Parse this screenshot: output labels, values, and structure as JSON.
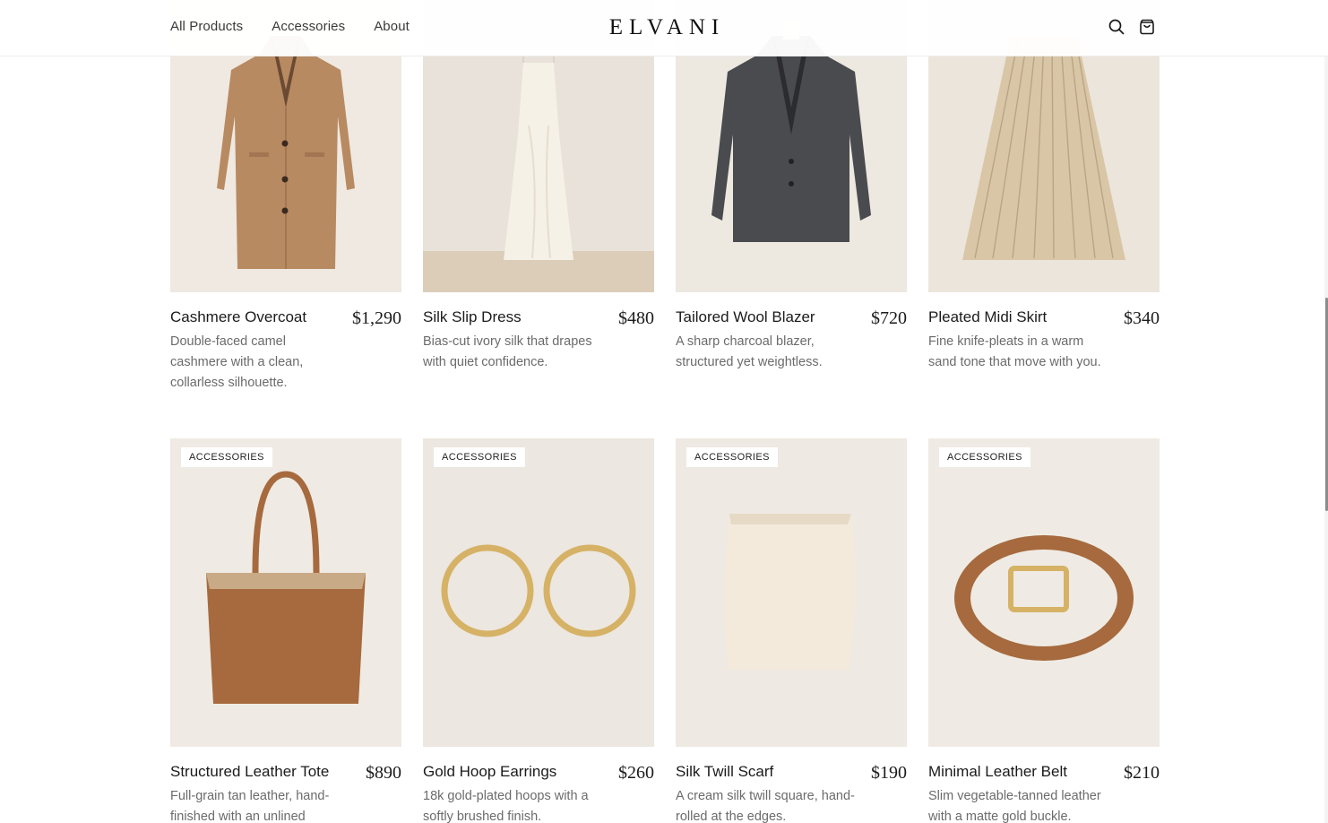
{
  "nav": {
    "links": [
      "All Products",
      "Accessories",
      "About"
    ],
    "logo": "ELVANI",
    "search_icon": "search-icon",
    "cart_icon": "shopping-bag-icon"
  },
  "products": [
    {
      "name": "Cashmere Overcoat",
      "price": "$1,290",
      "description": "Double-faced camel cashmere with a clean, collarless silhouette.",
      "badge": ""
    },
    {
      "name": "Silk Slip Dress",
      "price": "$480",
      "description": "Bias-cut ivory silk that drapes with quiet confidence.",
      "badge": ""
    },
    {
      "name": "Tailored Wool Blazer",
      "price": "$720",
      "description": "A sharp charcoal blazer, structured yet weightless.",
      "badge": ""
    },
    {
      "name": "Pleated Midi Skirt",
      "price": "$340",
      "description": "Fine knife-pleats in a warm sand tone that move with you.",
      "badge": ""
    },
    {
      "name": "Structured Leather Tote",
      "price": "$890",
      "description": "Full-grain tan leather, hand-finished with an unlined",
      "badge": "ACCESSORIES"
    },
    {
      "name": "Gold Hoop Earrings",
      "price": "$260",
      "description": "18k gold-plated hoops with a softly brushed finish.",
      "badge": "ACCESSORIES"
    },
    {
      "name": "Silk Twill Scarf",
      "price": "$190",
      "description": "A cream silk twill square, hand-rolled at the edges.",
      "badge": "ACCESSORIES"
    },
    {
      "name": "Minimal Leather Belt",
      "price": "$210",
      "description": "Slim vegetable-tanned leather with a matte gold buckle.",
      "badge": "ACCESSORIES"
    }
  ],
  "colors": {
    "image_bg": "#efebe4",
    "camel": "#b88a62",
    "charcoal": "#4a4b4f",
    "sand": "#d9c6a6",
    "gold": "#d6b266",
    "tan_leather": "#a66a3e"
  }
}
